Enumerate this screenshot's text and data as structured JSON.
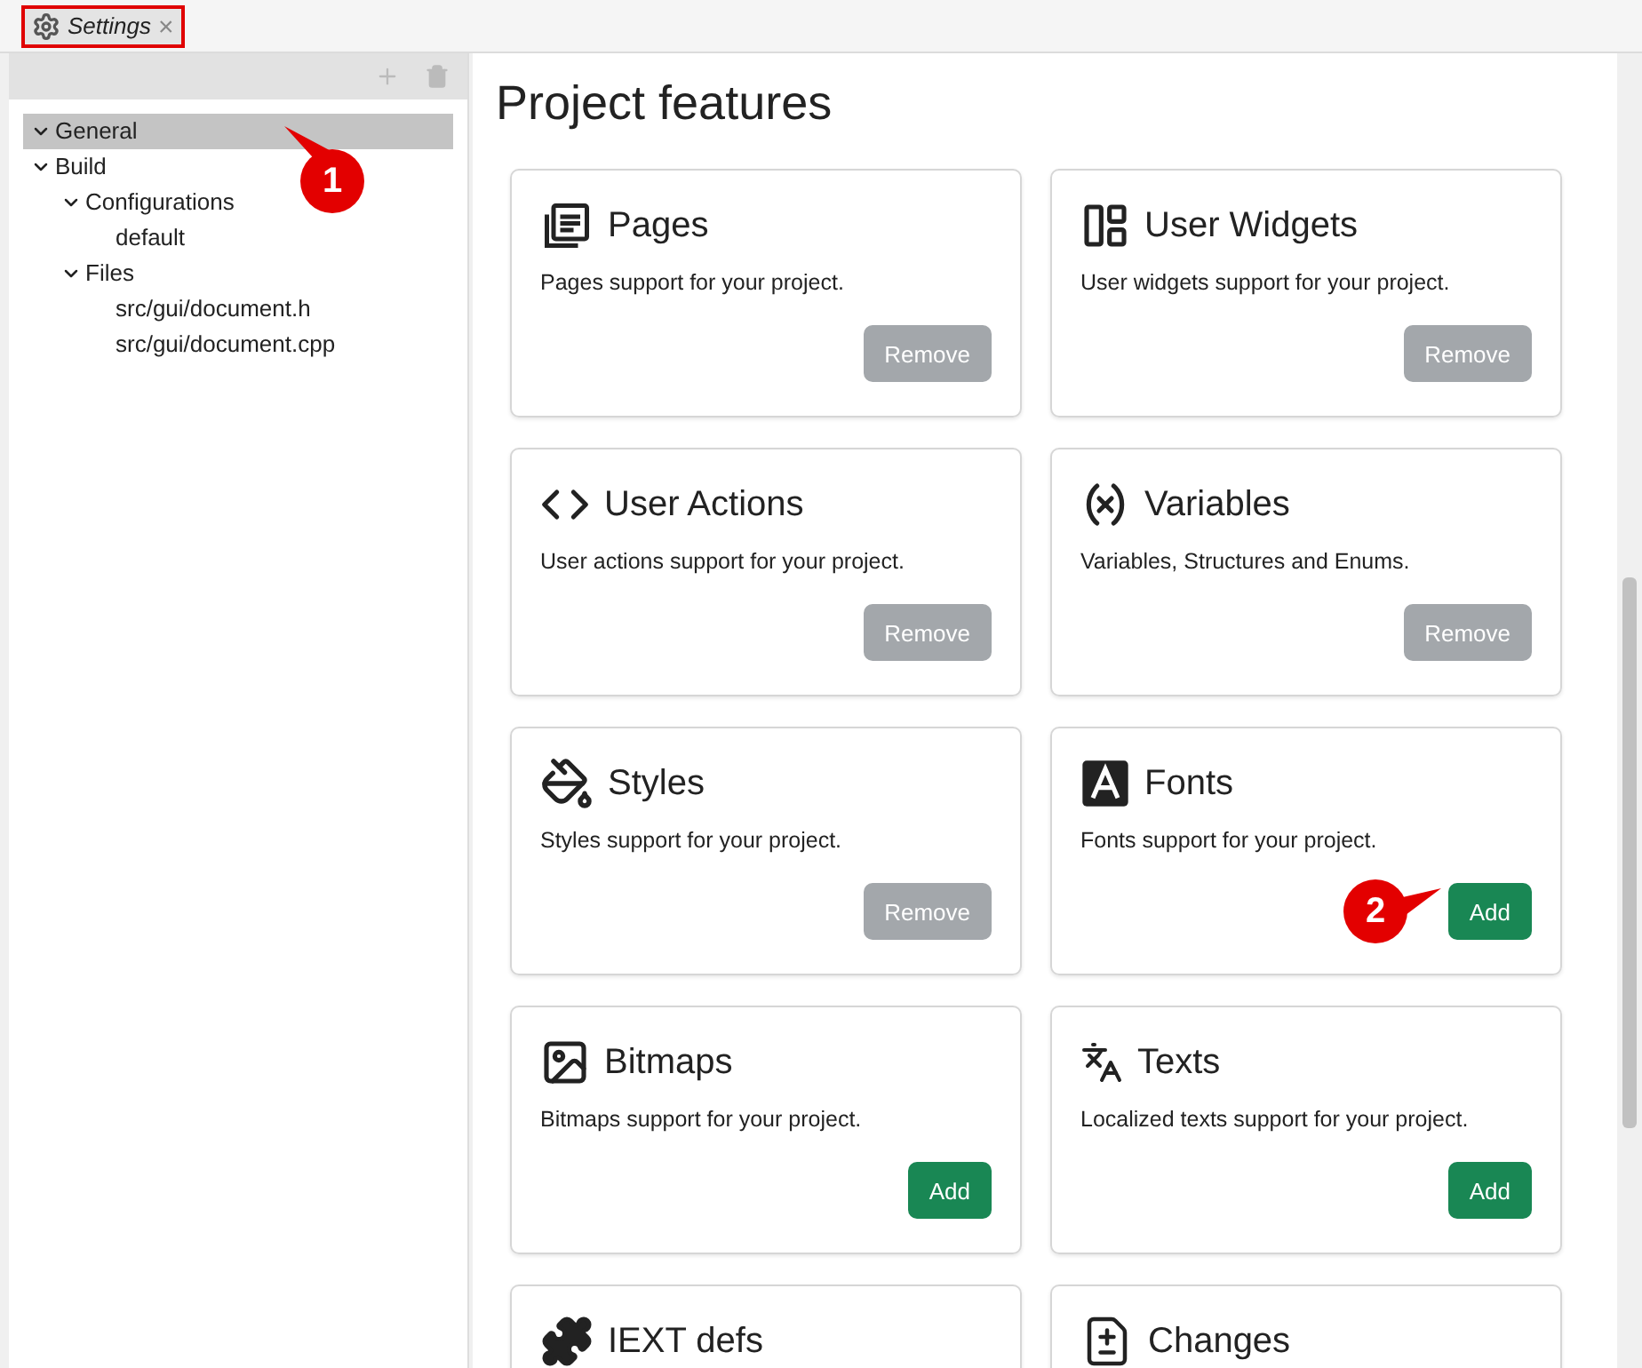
{
  "tab": {
    "title": "Settings",
    "close": "×"
  },
  "tree": [
    {
      "label": "General",
      "selected": true,
      "expanded": true
    },
    {
      "label": "Build",
      "selected": false,
      "expanded": true,
      "children": [
        {
          "label": "Configurations",
          "selected": false,
          "expanded": true,
          "children": [
            {
              "label": "default",
              "selected": false
            }
          ]
        },
        {
          "label": "Files",
          "selected": false,
          "expanded": true,
          "children": [
            {
              "label": "src/gui/document.h",
              "selected": false
            },
            {
              "label": "src/gui/document.cpp",
              "selected": false
            }
          ]
        }
      ]
    }
  ],
  "heading": "Project features",
  "features": [
    {
      "title": "Pages",
      "description": "Pages support for your project.",
      "button": {
        "label": "Remove",
        "kind": "remove"
      }
    },
    {
      "title": "User Widgets",
      "description": "User widgets support for your project.",
      "button": {
        "label": "Remove",
        "kind": "remove"
      }
    },
    {
      "title": "User Actions",
      "description": "User actions support for your project.",
      "button": {
        "label": "Remove",
        "kind": "remove"
      }
    },
    {
      "title": "Variables",
      "description": "Variables, Structures and Enums.",
      "button": {
        "label": "Remove",
        "kind": "remove"
      }
    },
    {
      "title": "Styles",
      "description": "Styles support for your project.",
      "button": {
        "label": "Remove",
        "kind": "remove"
      }
    },
    {
      "title": "Fonts",
      "description": "Fonts support for your project.",
      "button": {
        "label": "Add",
        "kind": "add"
      }
    },
    {
      "title": "Bitmaps",
      "description": "Bitmaps support for your project.",
      "button": {
        "label": "Add",
        "kind": "add"
      }
    },
    {
      "title": "Texts",
      "description": "Localized texts support for your project.",
      "button": {
        "label": "Add",
        "kind": "add"
      }
    },
    {
      "title": "IEXT defs"
    },
    {
      "title": "Changes"
    }
  ],
  "callouts": [
    "1",
    "2"
  ]
}
